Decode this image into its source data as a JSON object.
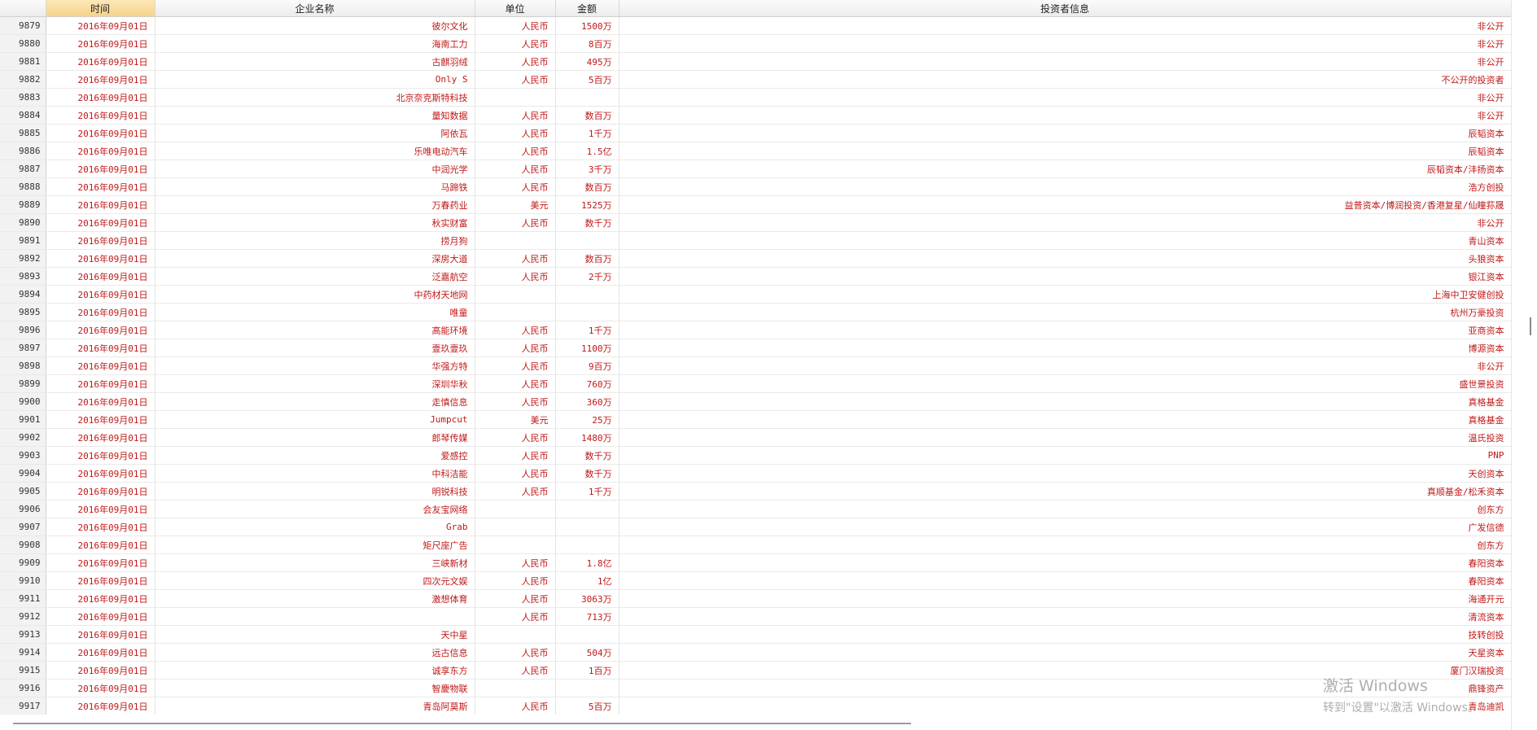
{
  "columns": [
    "时间",
    "企业名称",
    "单位",
    "金额",
    "投资者信息"
  ],
  "rows": [
    {
      "id": "9879",
      "date": "2016年09月01日",
      "company": "彼尔文化",
      "unit": "人民币",
      "amount": "1500万",
      "investor": "非公开"
    },
    {
      "id": "9880",
      "date": "2016年09月01日",
      "company": "海南工力",
      "unit": "人民币",
      "amount": "8百万",
      "investor": "非公开"
    },
    {
      "id": "9881",
      "date": "2016年09月01日",
      "company": "古麒羽绒",
      "unit": "人民币",
      "amount": "495万",
      "investor": "非公开"
    },
    {
      "id": "9882",
      "date": "2016年09月01日",
      "company": "Only S",
      "unit": "人民币",
      "amount": "5百万",
      "investor": "不公开的投资者"
    },
    {
      "id": "9883",
      "date": "2016年09月01日",
      "company": "北京奈克斯特科技",
      "unit": "",
      "amount": "",
      "investor": "非公开"
    },
    {
      "id": "9884",
      "date": "2016年09月01日",
      "company": "量知数据",
      "unit": "人民币",
      "amount": "数百万",
      "investor": "非公开"
    },
    {
      "id": "9885",
      "date": "2016年09月01日",
      "company": "阿依瓦",
      "unit": "人民币",
      "amount": "1千万",
      "investor": "辰韬资本"
    },
    {
      "id": "9886",
      "date": "2016年09月01日",
      "company": "乐唯电动汽车",
      "unit": "人民币",
      "amount": "1.5亿",
      "investor": "辰韬资本"
    },
    {
      "id": "9887",
      "date": "2016年09月01日",
      "company": "中润光学",
      "unit": "人民币",
      "amount": "3千万",
      "investor": "辰韬资本/沣扬资本"
    },
    {
      "id": "9888",
      "date": "2016年09月01日",
      "company": "马蹄铁",
      "unit": "人民币",
      "amount": "数百万",
      "investor": "浩方创投"
    },
    {
      "id": "9889",
      "date": "2016年09月01日",
      "company": "万春药业",
      "unit": "美元",
      "amount": "1525万",
      "investor": "益普资本/博润投资/香港复星/仙瞳荪晟"
    },
    {
      "id": "9890",
      "date": "2016年09月01日",
      "company": "秋实财富",
      "unit": "人民币",
      "amount": "数千万",
      "investor": "非公开"
    },
    {
      "id": "9891",
      "date": "2016年09月01日",
      "company": "捞月狗",
      "unit": "",
      "amount": "",
      "investor": "青山资本"
    },
    {
      "id": "9892",
      "date": "2016年09月01日",
      "company": "深房大道",
      "unit": "人民币",
      "amount": "数百万",
      "investor": "头狼资本"
    },
    {
      "id": "9893",
      "date": "2016年09月01日",
      "company": "泛嘉航空",
      "unit": "人民币",
      "amount": "2千万",
      "investor": "银江资本"
    },
    {
      "id": "9894",
      "date": "2016年09月01日",
      "company": "中药材天地网",
      "unit": "",
      "amount": "",
      "investor": "上海中卫安健创投"
    },
    {
      "id": "9895",
      "date": "2016年09月01日",
      "company": "唯童",
      "unit": "",
      "amount": "",
      "investor": "杭州万豪投资"
    },
    {
      "id": "9896",
      "date": "2016年09月01日",
      "company": "高能环境",
      "unit": "人民币",
      "amount": "1千万",
      "investor": "亚商资本"
    },
    {
      "id": "9897",
      "date": "2016年09月01日",
      "company": "壹玖壹玖",
      "unit": "人民币",
      "amount": "1100万",
      "investor": "博源资本"
    },
    {
      "id": "9898",
      "date": "2016年09月01日",
      "company": "华强方特",
      "unit": "人民币",
      "amount": "9百万",
      "investor": "非公开"
    },
    {
      "id": "9899",
      "date": "2016年09月01日",
      "company": "深圳华秋",
      "unit": "人民币",
      "amount": "760万",
      "investor": "盛世景投资"
    },
    {
      "id": "9900",
      "date": "2016年09月01日",
      "company": "走慎信息",
      "unit": "人民币",
      "amount": "360万",
      "investor": "真格基金"
    },
    {
      "id": "9901",
      "date": "2016年09月01日",
      "company": "Jumpcut",
      "unit": "美元",
      "amount": "25万",
      "investor": "真格基金"
    },
    {
      "id": "9902",
      "date": "2016年09月01日",
      "company": "郎琴传媒",
      "unit": "人民币",
      "amount": "1480万",
      "investor": "温氏投资"
    },
    {
      "id": "9903",
      "date": "2016年09月01日",
      "company": "爱感控",
      "unit": "人民币",
      "amount": "数千万",
      "investor": "PNP"
    },
    {
      "id": "9904",
      "date": "2016年09月01日",
      "company": "中科洁能",
      "unit": "人民币",
      "amount": "数千万",
      "investor": "天创资本"
    },
    {
      "id": "9905",
      "date": "2016年09月01日",
      "company": "明锐科技",
      "unit": "人民币",
      "amount": "1千万",
      "investor": "真顺基金/松禾资本"
    },
    {
      "id": "9906",
      "date": "2016年09月01日",
      "company": "会友宝网络",
      "unit": "",
      "amount": "",
      "investor": "创东方"
    },
    {
      "id": "9907",
      "date": "2016年09月01日",
      "company": "Grab",
      "unit": "",
      "amount": "",
      "investor": "广发信德"
    },
    {
      "id": "9908",
      "date": "2016年09月01日",
      "company": "矩尺座广告",
      "unit": "",
      "amount": "",
      "investor": "创东方"
    },
    {
      "id": "9909",
      "date": "2016年09月01日",
      "company": "三峡新材",
      "unit": "人民币",
      "amount": "1.8亿",
      "investor": "春阳资本"
    },
    {
      "id": "9910",
      "date": "2016年09月01日",
      "company": "四次元文娱",
      "unit": "人民币",
      "amount": "1亿",
      "investor": "春阳资本"
    },
    {
      "id": "9911",
      "date": "2016年09月01日",
      "company": "激想体育",
      "unit": "人民币",
      "amount": "3063万",
      "investor": "海通开元"
    },
    {
      "id": "9912",
      "date": "2016年09月01日",
      "company": "",
      "unit": "人民币",
      "amount": "713万",
      "investor": "清流资本"
    },
    {
      "id": "9913",
      "date": "2016年09月01日",
      "company": "天中星",
      "unit": "",
      "amount": "",
      "investor": "技转创投"
    },
    {
      "id": "9914",
      "date": "2016年09月01日",
      "company": "远古信息",
      "unit": "人民币",
      "amount": "504万",
      "investor": "天星资本"
    },
    {
      "id": "9915",
      "date": "2016年09月01日",
      "company": "诚享东方",
      "unit": "人民币",
      "amount": "1百万",
      "investor": "厦门汉瑞投资"
    },
    {
      "id": "9916",
      "date": "2016年09月01日",
      "company": "智慶物联",
      "unit": "",
      "amount": "",
      "investor": "鼎锋资产"
    },
    {
      "id": "9917",
      "date": "2016年09月01日",
      "company": "青岛阿莫斯",
      "unit": "人民币",
      "amount": "5百万",
      "investor": "青岛迪凯"
    }
  ],
  "watermark": {
    "title": "激活 Windows",
    "subtitle": "转到\"设置\"以激活 Windows。"
  },
  "colors": {
    "cell_text": "#c01818",
    "sorted_header": "#f5d489"
  }
}
